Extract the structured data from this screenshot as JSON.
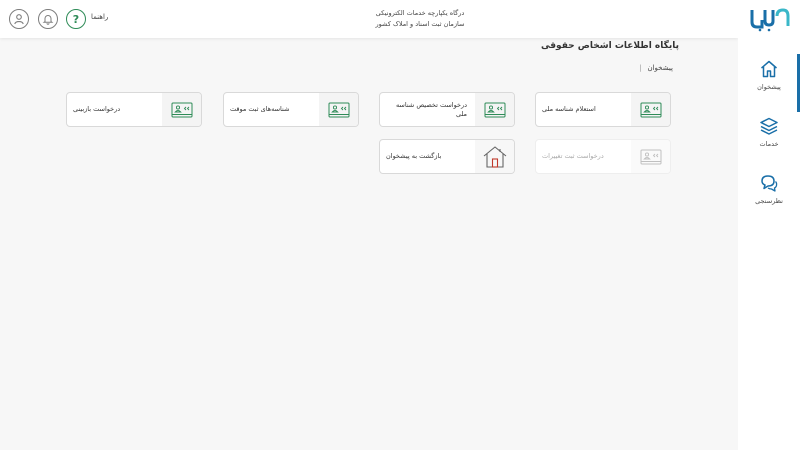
{
  "header": {
    "title_line1": "درگاه یکپارچه خدمات الکترونیکی",
    "title_line2": "سازمان ثبت اسناد و املاک کشور",
    "help_label": "راهنما",
    "icons": [
      "user-icon",
      "bell-icon",
      "help-icon"
    ]
  },
  "sidebar": {
    "items": [
      {
        "label": "پیشخوان",
        "icon": "home-icon",
        "active": true
      },
      {
        "label": "خدمات",
        "icon": "layers-icon",
        "active": false
      },
      {
        "label": "نظرسنجی",
        "icon": "chat-icon",
        "active": false
      }
    ]
  },
  "page": {
    "title": "پایگاه اطلاعات اشخاص حقوقی",
    "breadcrumb": [
      "پیشخوان",
      "|"
    ]
  },
  "cards": [
    {
      "label": "استعلام شناسه ملی",
      "icon": "id-card-icon",
      "enabled": true
    },
    {
      "label": "درخواست تخصیص شناسه ملی",
      "icon": "id-card-icon",
      "enabled": true
    },
    {
      "label": "شناسه‌های ثبت موقت",
      "icon": "id-card-icon",
      "enabled": true
    },
    {
      "label": "درخواست بازبینی",
      "icon": "id-card-icon",
      "enabled": true
    },
    {
      "label": "درخواست ثبت تغییرات",
      "icon": "id-card-icon",
      "enabled": false
    },
    {
      "label": "بازگشت به پیشخوان",
      "icon": "house-icon",
      "enabled": true
    }
  ],
  "colors": {
    "accent": "#1a6fa8",
    "card_icon": "#2e8b57",
    "house_icon": "#c0392b",
    "background": "#f7f7f7"
  }
}
